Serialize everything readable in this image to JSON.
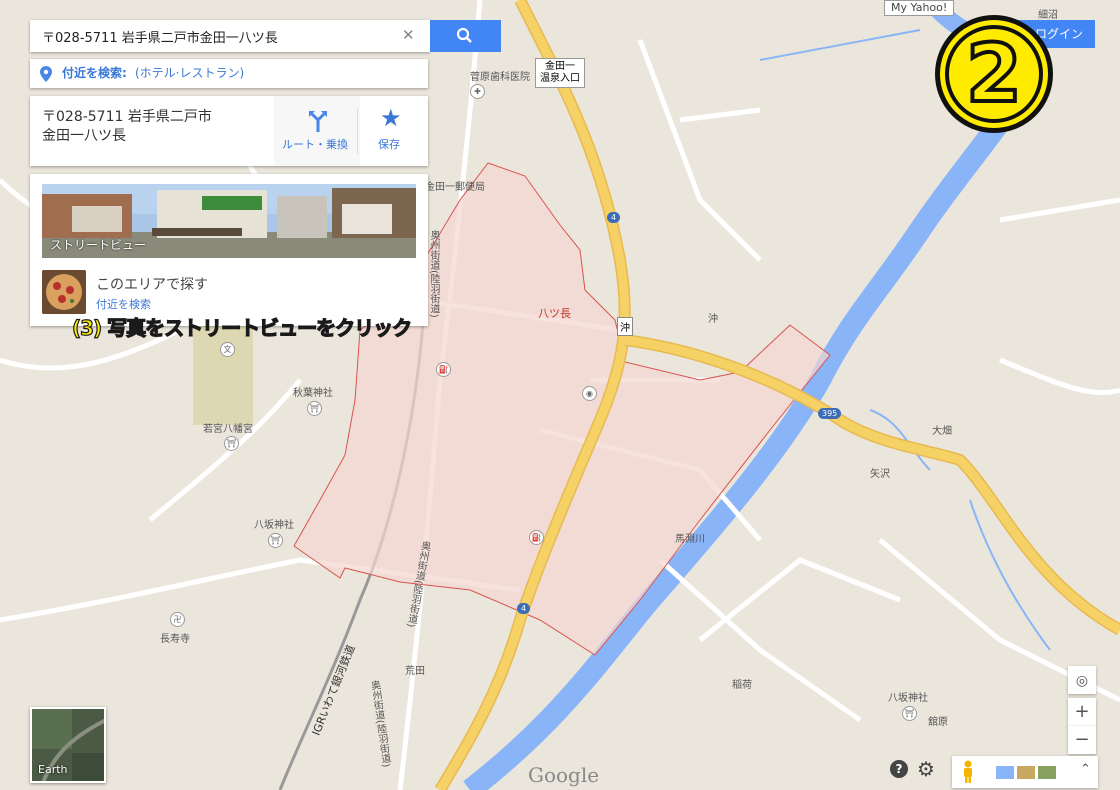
{
  "search": {
    "query": "〒028-5711 岩手県二戸市金田一八ツ長",
    "clear_glyph": "✕",
    "button_icon": "search-icon"
  },
  "nearby": {
    "prefix": "付近を検索:",
    "link": "(ホテル·レストラン)"
  },
  "place_card": {
    "address_line1": "〒028-5711 岩手県二戸市",
    "address_line2": "金田一八ツ長",
    "route_label": "ルート・乗換",
    "save_label": "保存"
  },
  "media_card": {
    "streetview_label": "ストリートビュー",
    "explore_title": "このエリアで探す",
    "explore_link": "付近を検索"
  },
  "annotation": {
    "instruction": "(3) 写真をストリートビューをクリック",
    "step_number": "2"
  },
  "top": {
    "yahoo_tab": "My Yahoo!",
    "login_label": "ログイン"
  },
  "map_labels": {
    "sugawara": "菅原歯科医院",
    "kindaichi_onsen_1": "金田一",
    "kindaichi_onsen_2": "温泉入口",
    "post_office": "金田一郵便局",
    "oshu_kaido_1": "奥州街道(陸羽街道)",
    "yatsuo": "八ツ長",
    "oki_shield": "沖",
    "oki": "沖",
    "route4_a": "4",
    "route4_b": "4",
    "route395": "395",
    "akiba": "秋葉神社",
    "wakamiya": "若宮八幡宮",
    "yasaka": "八坂神社",
    "choju": "長寿寺",
    "ara_ta": "荒田",
    "oshu_kaido_2": "奥州街道(陸羽街道)",
    "oshu_kaido_3": "奥州街道(陸羽街道)",
    "igr": "IGRいわて銀河鉄道",
    "mabuchi": "馬淵川",
    "yazawa": "矢沢",
    "ohata": "大畑",
    "inari": "稲荷",
    "yasaka2": "八坂神社",
    "tatehara": "舘原",
    "hosozawa": "細沼",
    "google": "Google",
    "earth": "Earth",
    "oki_area": "沖"
  },
  "controls": {
    "zoom_in": "+",
    "zoom_out": "−",
    "locate_icon": "locate-icon",
    "help_icon": "help-icon",
    "settings_icon": "gear-icon",
    "pegman_icon": "pegman-icon",
    "expand_icon": "chevron-up-icon"
  },
  "colors": {
    "accent": "#4285f4",
    "highway": "#f6d266",
    "river": "#8ab4f8",
    "area_border": "#d9534f",
    "annotation_yellow": "#ffeb00"
  }
}
